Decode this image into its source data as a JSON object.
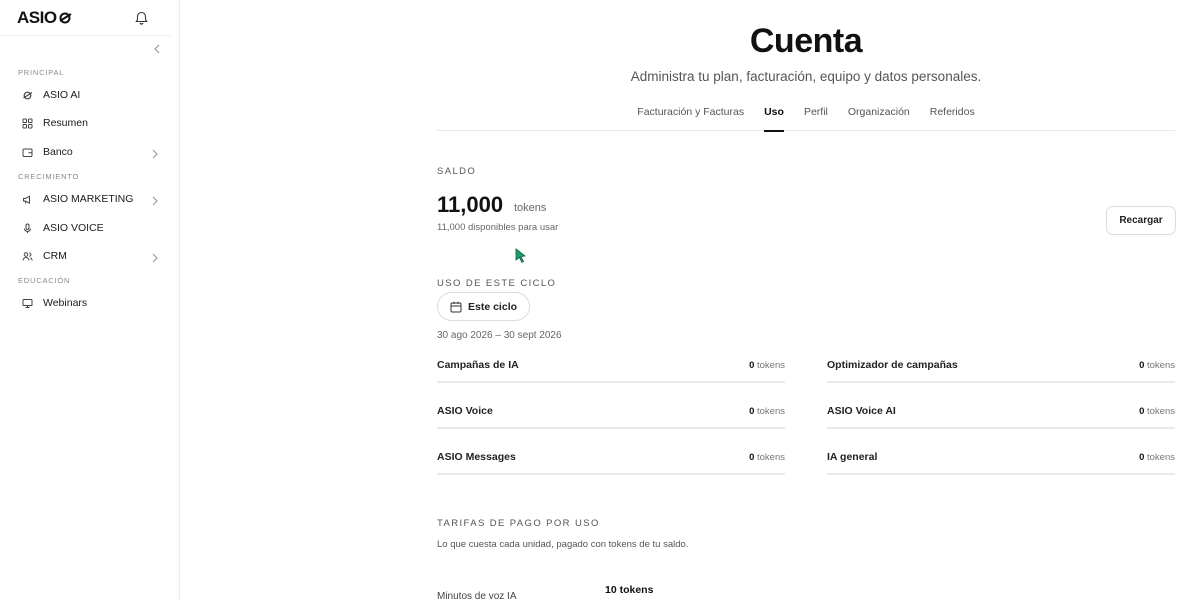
{
  "sidebar": {
    "logo": "ASIO",
    "sections": {
      "principal": "PRINCIPAL",
      "crecimiento": "CRECIMIENTO",
      "educacion": "EDUCACIÓN"
    },
    "items": [
      {
        "label": "ASIO AI",
        "icon": "asio-ai-icon"
      },
      {
        "label": "Resumen",
        "icon": "grid-icon"
      },
      {
        "label": "Banco",
        "icon": "wallet-icon"
      },
      {
        "label": "ASIO MARKETING",
        "icon": "megaphone-icon"
      },
      {
        "label": "ASIO VOICE",
        "icon": "microphone-icon"
      },
      {
        "label": "CRM",
        "icon": "users-icon"
      },
      {
        "label": "Webinars",
        "icon": "monitor-icon"
      }
    ]
  },
  "header": {
    "title": "Cuenta",
    "subtitle": "Administra tu plan, facturación, equipo y datos personales."
  },
  "tabs": [
    {
      "label": "Facturación y Facturas"
    },
    {
      "label": "Uso",
      "active": true
    },
    {
      "label": "Perfil"
    },
    {
      "label": "Organización"
    },
    {
      "label": "Referidos"
    }
  ],
  "saldo": {
    "label": "SALDO",
    "amount": "11,000",
    "unit": "tokens",
    "available": "11,000 disponibles para usar",
    "recharge_label": "Recargar"
  },
  "cycle": {
    "label": "USO DE ESTE CICLO",
    "button": "Este ciclo",
    "range": "30 ago 2026 – 30 sept 2026",
    "usage": [
      {
        "name": "Campañas de IA",
        "amount": "0",
        "unit": "tokens"
      },
      {
        "name": "Optimizador de campañas",
        "amount": "0",
        "unit": "tokens"
      },
      {
        "name": "ASIO Voice",
        "amount": "0",
        "unit": "tokens"
      },
      {
        "name": "ASIO Voice AI",
        "amount": "0",
        "unit": "tokens"
      },
      {
        "name": "ASIO Messages",
        "amount": "0",
        "unit": "tokens"
      },
      {
        "name": "IA general",
        "amount": "0",
        "unit": "tokens"
      }
    ]
  },
  "tarifas": {
    "label": "TARIFAS DE PAGO POR USO",
    "description": "Lo que cuesta cada unidad, pagado con tokens de tu saldo.",
    "rates": [
      {
        "name": "Minutos de voz IA",
        "value": "10 tokens"
      }
    ]
  },
  "colors": {
    "accent": "#111111",
    "border": "#e9e9e9",
    "cursor": "#1e9e6a"
  }
}
